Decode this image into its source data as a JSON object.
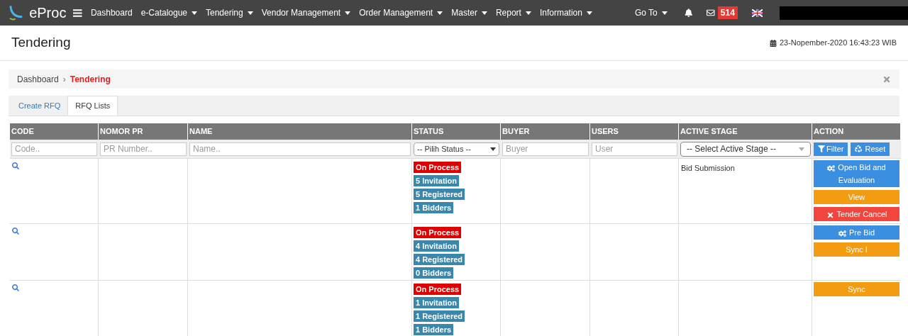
{
  "navbar": {
    "brand": "eProc",
    "menu": [
      {
        "label": "Dashboard",
        "dropdown": false
      },
      {
        "label": "e-Catalogue",
        "dropdown": true
      },
      {
        "label": "Tendering",
        "dropdown": true
      },
      {
        "label": "Vendor Management",
        "dropdown": true
      },
      {
        "label": "Order Management",
        "dropdown": true
      },
      {
        "label": "Master",
        "dropdown": true
      },
      {
        "label": "Report",
        "dropdown": true
      },
      {
        "label": "Information",
        "dropdown": true
      }
    ],
    "goto": "Go To",
    "mail_count": "514"
  },
  "page": {
    "title": "Tendering",
    "datetime": "23-Nopember-2020 16:43:23 WIB"
  },
  "breadcrumb_separator": "›",
  "breadcrumb": [
    {
      "label": "Dashboard",
      "selected": false
    },
    {
      "label": "Tendering",
      "selected": true
    }
  ],
  "tabs": [
    {
      "label": "Create RFQ",
      "selected": false
    },
    {
      "label": "RFQ Lists",
      "selected": true
    }
  ],
  "table": {
    "columns": [
      "CODE",
      "NOMOR PR",
      "NAME",
      "STATUS",
      "BUYER",
      "USERS",
      "ACTIVE STAGE",
      "ACTION"
    ],
    "filters": {
      "code": {
        "placeholder": "Code.."
      },
      "pr": {
        "placeholder": "PR Number.."
      },
      "name": {
        "placeholder": "Name.."
      },
      "status": "-- Pilih Status --",
      "buyer": {
        "placeholder": "Buyer"
      },
      "user": {
        "placeholder": "User"
      },
      "stage": "-- Select Active Stage --",
      "filter_button": "Filter",
      "reset_button": "Reset"
    },
    "rows": [
      {
        "status": [
          {
            "label": "On Process",
            "kind": "danger"
          },
          {
            "label": "5 Invitation",
            "kind": "info"
          },
          {
            "label": "5 Registered",
            "kind": "info"
          },
          {
            "label": "1 Bidders",
            "kind": "info"
          }
        ],
        "active_stage": "Bid Submission",
        "actions": [
          {
            "label": "Open Bid and Evaluation",
            "kind": "primary"
          },
          {
            "label": "View",
            "kind": "warning"
          },
          {
            "label": "Tender Cancel",
            "kind": "danger"
          }
        ]
      },
      {
        "status": [
          {
            "label": "On Process",
            "kind": "danger"
          },
          {
            "label": "4 Invitation",
            "kind": "info"
          },
          {
            "label": "4 Registered",
            "kind": "info"
          },
          {
            "label": "0 Bidders",
            "kind": "info"
          }
        ],
        "actions": [
          {
            "label": "Pre Bid",
            "kind": "primary"
          },
          {
            "label": "Sync I",
            "kind": "warning"
          }
        ]
      },
      {
        "status": [
          {
            "label": "On Process",
            "kind": "danger"
          },
          {
            "label": "1 Invitation",
            "kind": "info"
          },
          {
            "label": "1 Registered",
            "kind": "info"
          },
          {
            "label": "1 Bidders",
            "kind": "info"
          }
        ],
        "actions": [
          {
            "label": "Sync",
            "kind": "warning"
          }
        ]
      }
    ]
  }
}
